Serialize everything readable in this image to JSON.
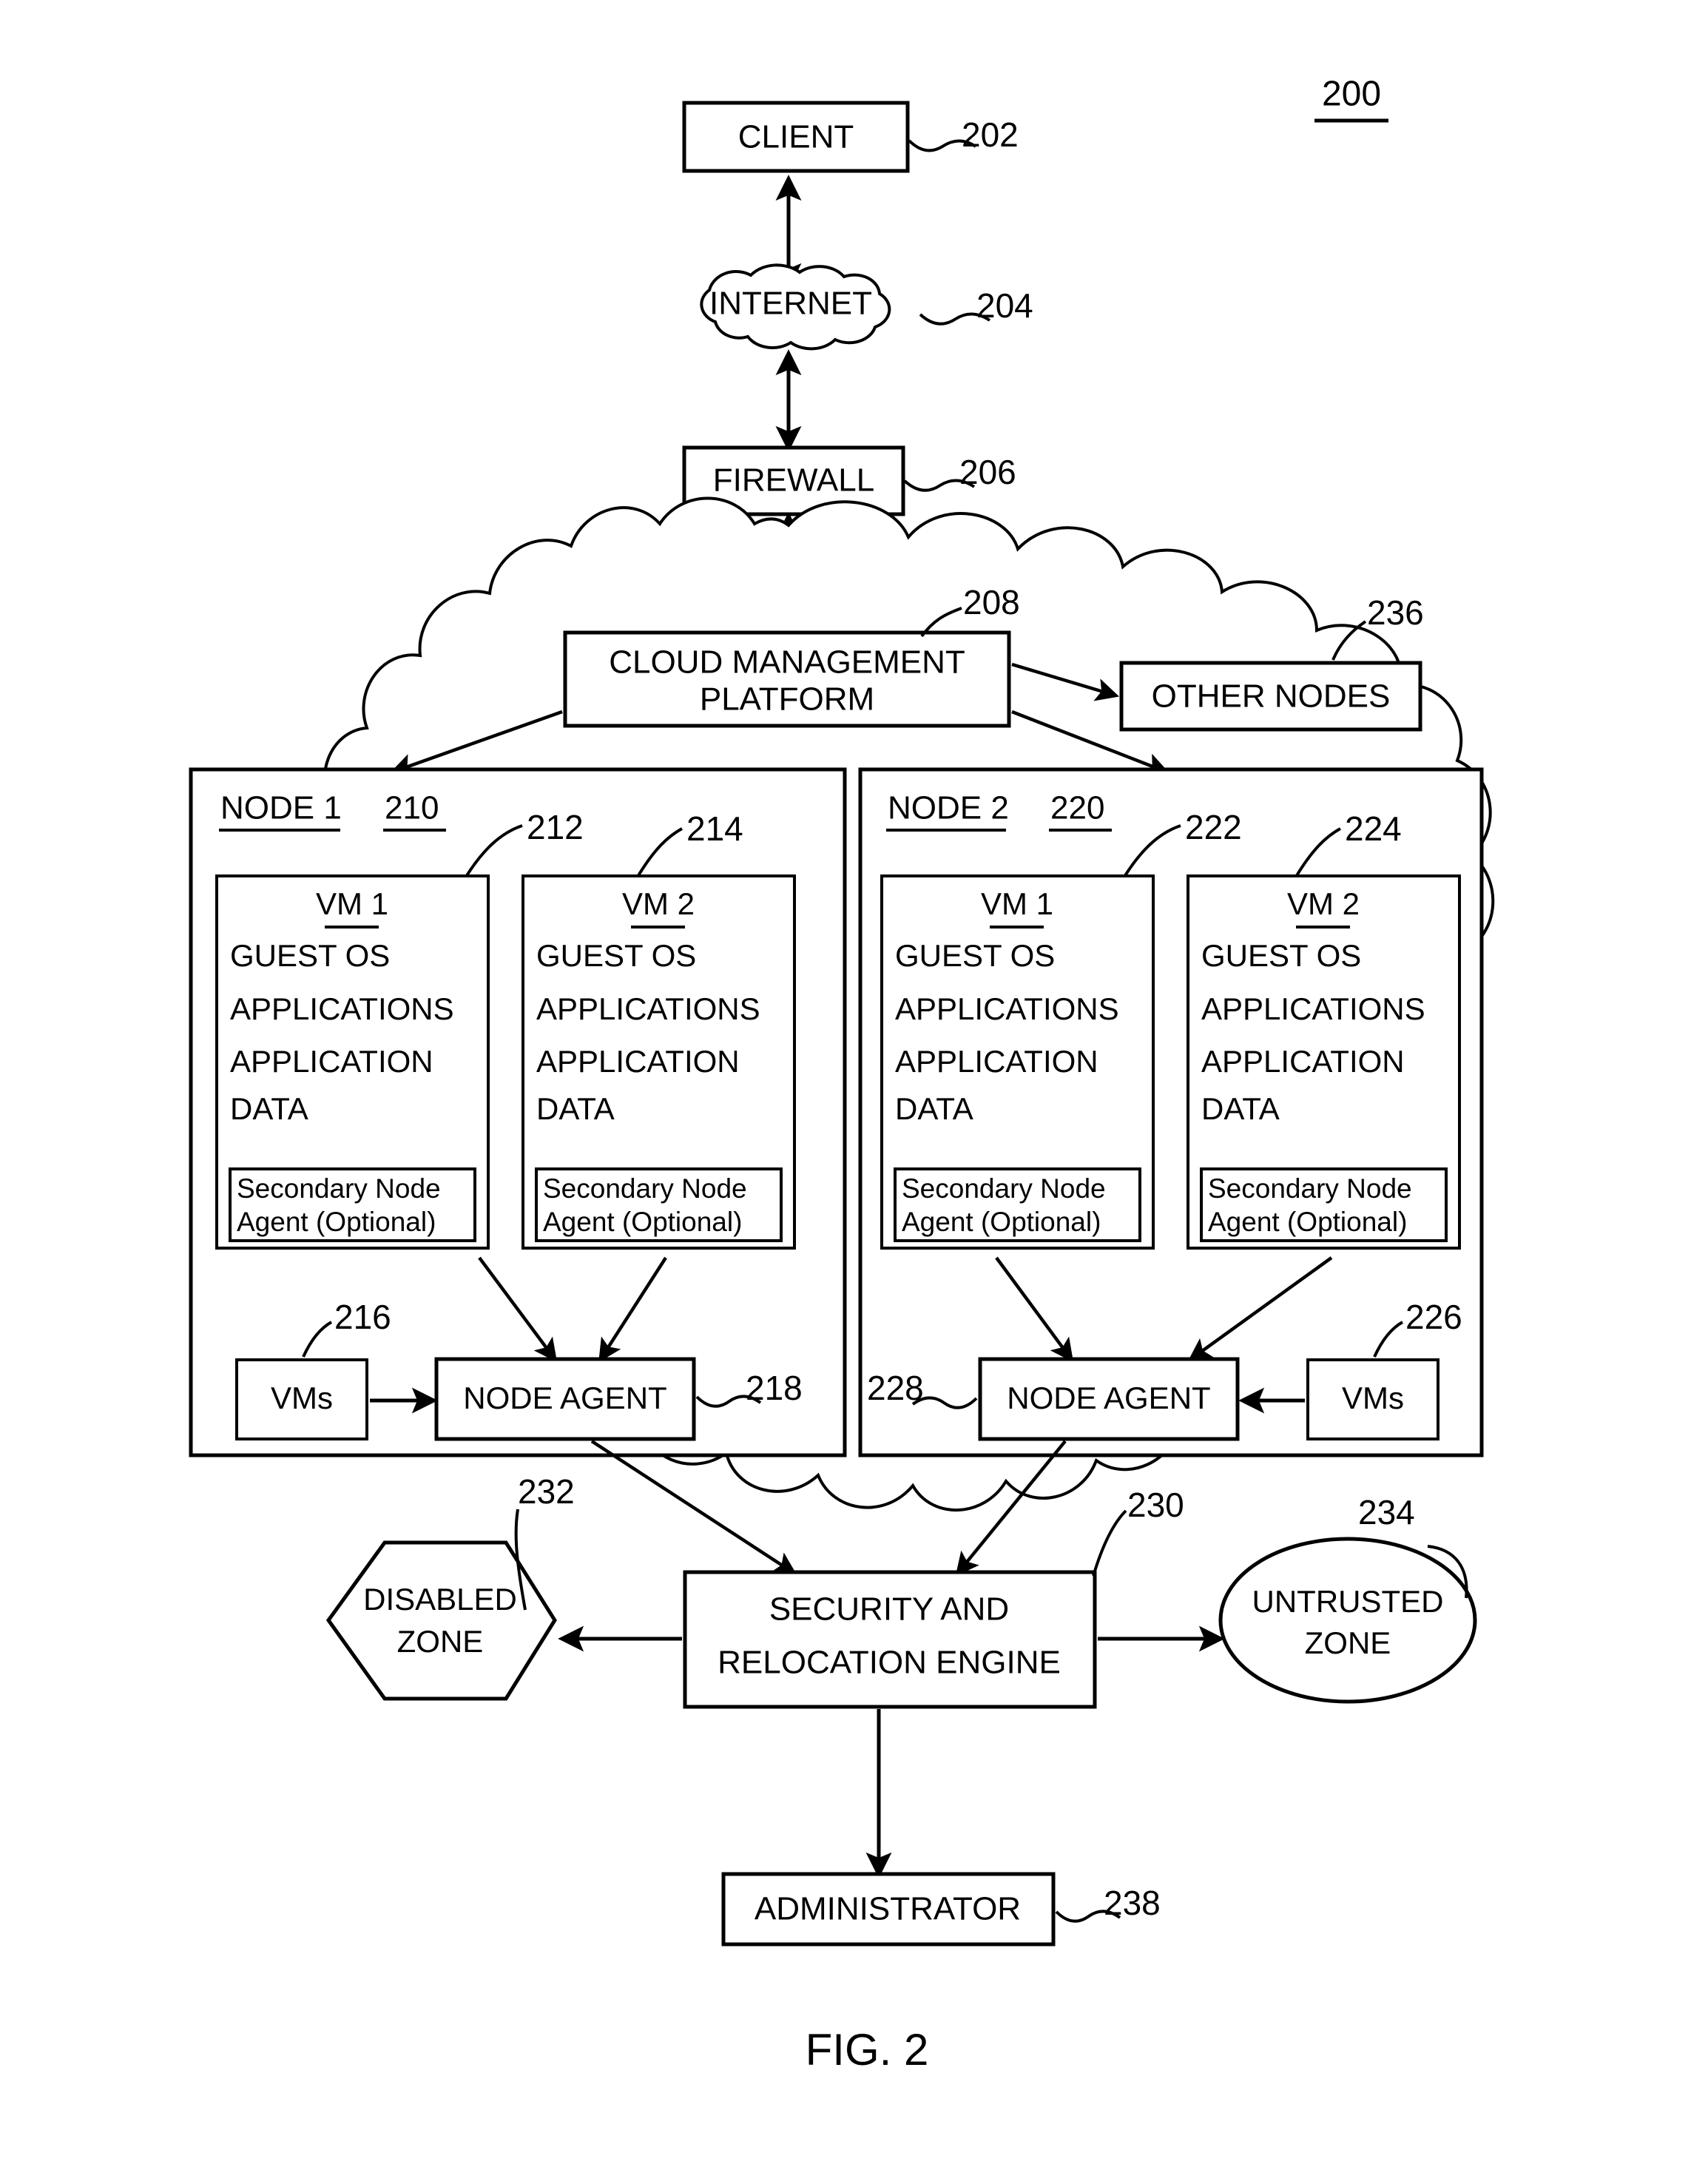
{
  "figure": {
    "number_label": "200",
    "caption": "FIG. 2"
  },
  "nodes": {
    "client": {
      "label": "CLIENT",
      "ref": "202"
    },
    "internet": {
      "label": "INTERNET",
      "ref": "204"
    },
    "firewall": {
      "label": "FIREWALL",
      "ref": "206"
    },
    "cloud_management_platform": {
      "label_line1": "CLOUD MANAGEMENT",
      "label_line2": "PLATFORM",
      "ref": "208"
    },
    "other_nodes": {
      "label": "OTHER NODES",
      "ref": "236"
    },
    "security_engine": {
      "label_line1": "SECURITY AND",
      "label_line2": "RELOCATION ENGINE",
      "ref": "230"
    },
    "disabled_zone": {
      "label_line1": "DISABLED",
      "label_line2": "ZONE",
      "ref": "232"
    },
    "untrusted_zone": {
      "label_line1": "UNTRUSTED",
      "label_line2": "ZONE",
      "ref": "234"
    },
    "administrator": {
      "label": "ADMINISTRATOR",
      "ref": "238"
    }
  },
  "node1": {
    "title": "NODE 1",
    "ref": "210",
    "vm1": {
      "title": "VM 1",
      "ref": "212",
      "lines": [
        "GUEST OS",
        "APPLICATIONS",
        "APPLICATION",
        "DATA"
      ],
      "agent_line1": "Secondary Node",
      "agent_line2": "Agent (Optional)"
    },
    "vm2": {
      "title": "VM 2",
      "ref": "214",
      "lines": [
        "GUEST OS",
        "APPLICATIONS",
        "APPLICATION",
        "DATA"
      ],
      "agent_line1": "Secondary Node",
      "agent_line2": "Agent (Optional)"
    },
    "vms_box": {
      "label": "VMs",
      "ref": "216"
    },
    "node_agent": {
      "label": "NODE AGENT",
      "ref": "218"
    }
  },
  "node2": {
    "title": "NODE 2",
    "ref": "220",
    "vm1": {
      "title": "VM 1",
      "ref": "222",
      "lines": [
        "GUEST OS",
        "APPLICATIONS",
        "APPLICATION",
        "DATA"
      ],
      "agent_line1": "Secondary Node",
      "agent_line2": "Agent (Optional)"
    },
    "vm2": {
      "title": "VM 2",
      "ref": "224",
      "lines": [
        "GUEST OS",
        "APPLICATIONS",
        "APPLICATION",
        "DATA"
      ],
      "agent_line1": "Secondary Node",
      "agent_line2": "Agent (Optional)"
    },
    "vms_box": {
      "label": "VMs",
      "ref": "226"
    },
    "node_agent": {
      "label": "NODE AGENT",
      "ref": "228"
    }
  },
  "colors": {
    "stroke": "#000000",
    "background": "#ffffff"
  }
}
